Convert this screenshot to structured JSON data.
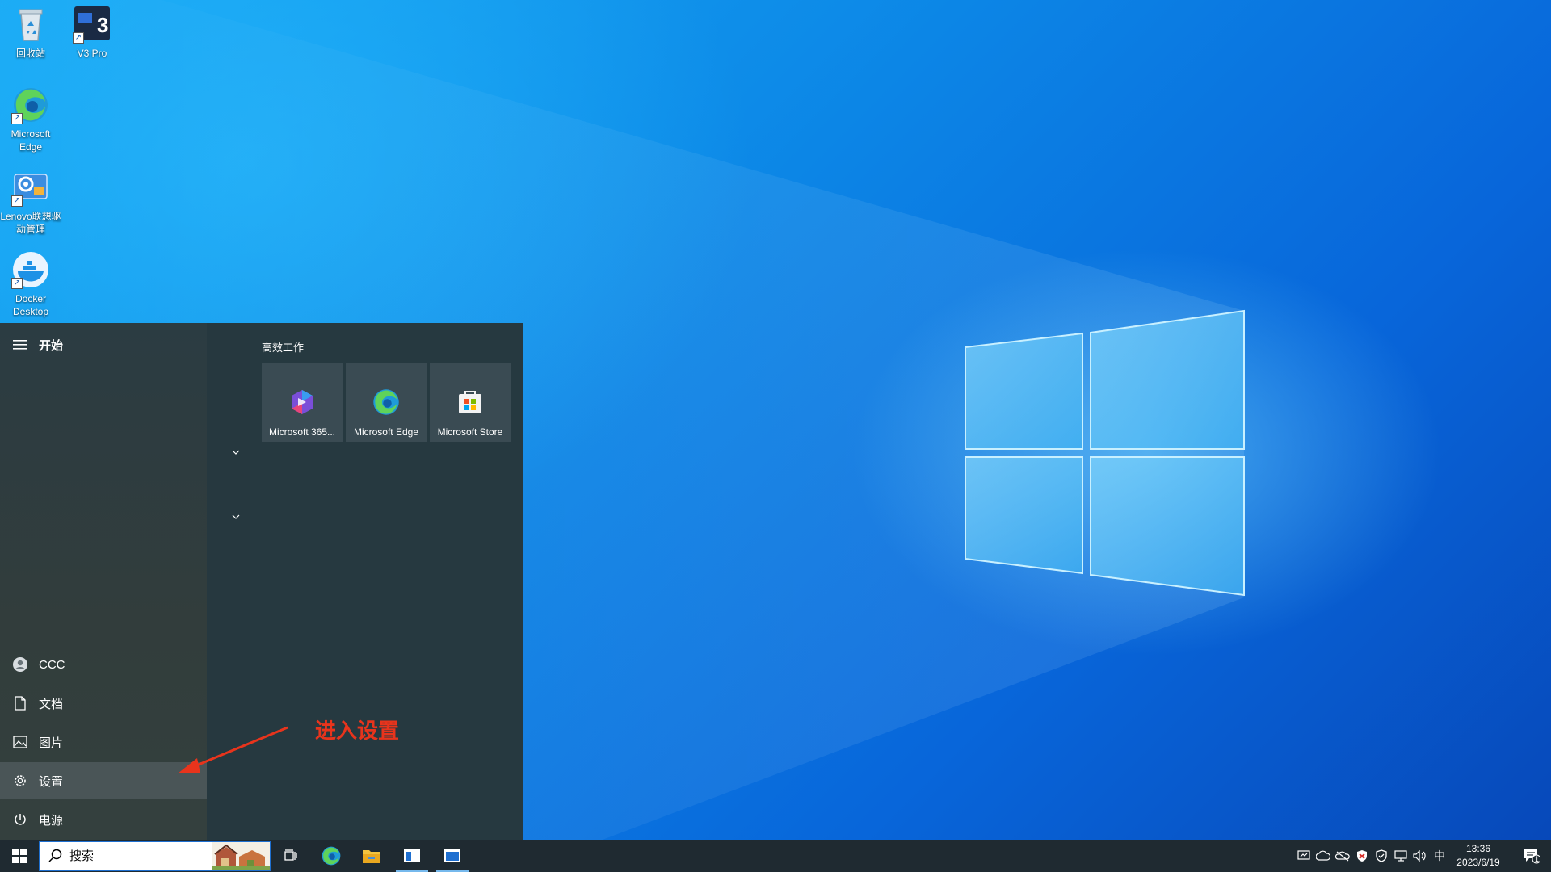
{
  "desktop": {
    "icons": [
      {
        "label": "回收站",
        "icon": "recycle-bin-icon"
      },
      {
        "label": "V3 Pro",
        "icon": "v3-pro-icon"
      },
      {
        "label": "Microsoft Edge",
        "icon": "edge-icon"
      },
      {
        "label": "Lenovo联想驱动管理",
        "icon": "lenovo-driver-icon"
      },
      {
        "label": "Docker Desktop",
        "icon": "docker-icon"
      }
    ]
  },
  "start_menu": {
    "header": "开始",
    "group_title": "高效工作",
    "tiles": [
      {
        "label": "Microsoft 365...",
        "icon": "microsoft-365-icon"
      },
      {
        "label": "Microsoft Edge",
        "icon": "edge-icon"
      },
      {
        "label": "Microsoft Store",
        "icon": "store-icon"
      }
    ],
    "left_items": [
      {
        "label": "CCC",
        "icon": "user-icon"
      },
      {
        "label": "文档",
        "icon": "document-icon"
      },
      {
        "label": "图片",
        "icon": "pictures-icon"
      },
      {
        "label": "设置",
        "icon": "gear-icon"
      },
      {
        "label": "电源",
        "icon": "power-icon"
      }
    ]
  },
  "annotation": {
    "text": "进入设置",
    "color": "#e8341c"
  },
  "taskbar": {
    "search_placeholder": "搜索",
    "pinned": [
      {
        "name": "task-view",
        "icon": "task-view-icon"
      },
      {
        "name": "edge",
        "icon": "edge-icon"
      },
      {
        "name": "file-explorer",
        "icon": "folder-icon"
      },
      {
        "name": "app-1",
        "icon": "window-app-icon"
      },
      {
        "name": "app-2",
        "icon": "window-app-icon"
      }
    ],
    "ime": "中",
    "time": "13:36",
    "date": "2023/6/19",
    "notification_count": "1"
  },
  "colors": {
    "accent": "#1e6fd0",
    "start_bg": "#263a44",
    "taskbar_bg": "#1f2a31"
  }
}
